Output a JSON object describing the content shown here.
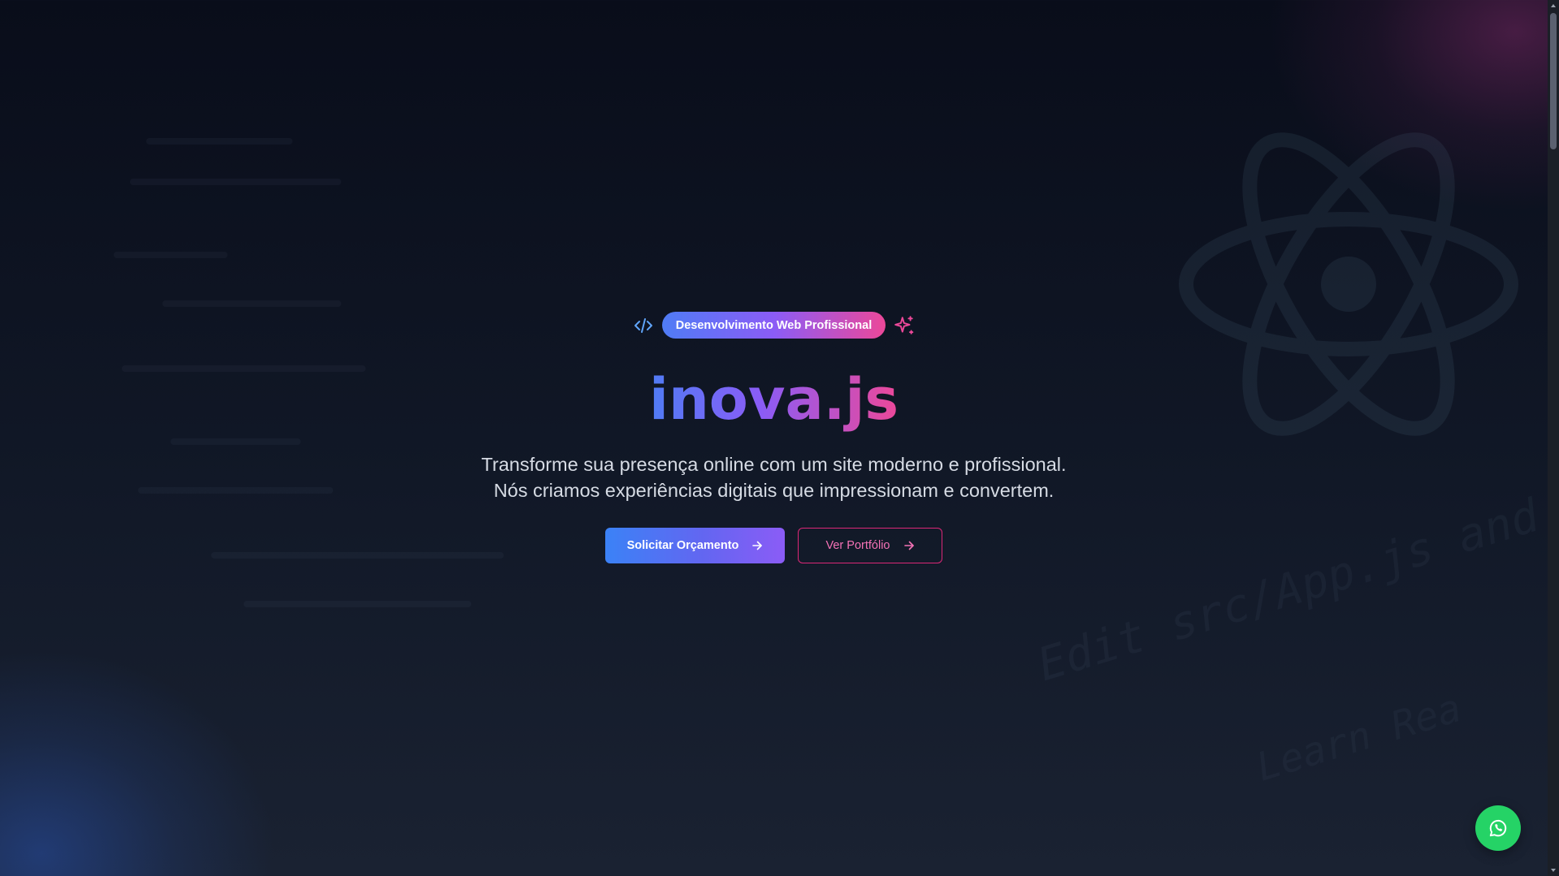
{
  "hero": {
    "badge_label": "Desenvolvimento Web Profissional",
    "brand_title": "inova.js",
    "subtitle_line1": "Transforme sua presença online com um site moderno e profissional.",
    "subtitle_line2": "Nós criamos experiências digitais que impressionam e convertem.",
    "primary_cta": "Solicitar Orçamento",
    "secondary_cta": "Ver Portfólio"
  },
  "background": {
    "code_text_1": "Edit src/App.js and save to",
    "code_text_2": "Learn Rea"
  },
  "icons": {
    "badge_left": "code-icon",
    "badge_right": "sparkle-icon",
    "cta_arrow": "arrow-right-icon",
    "floating": "whatsapp-icon",
    "background": "react-atom-icon"
  },
  "colors": {
    "gradient_start": "#4f7cf5",
    "gradient_mid": "#8b5cf6",
    "gradient_end": "#ec4899",
    "whatsapp_green": "#25d366",
    "background": "#0f1421"
  }
}
